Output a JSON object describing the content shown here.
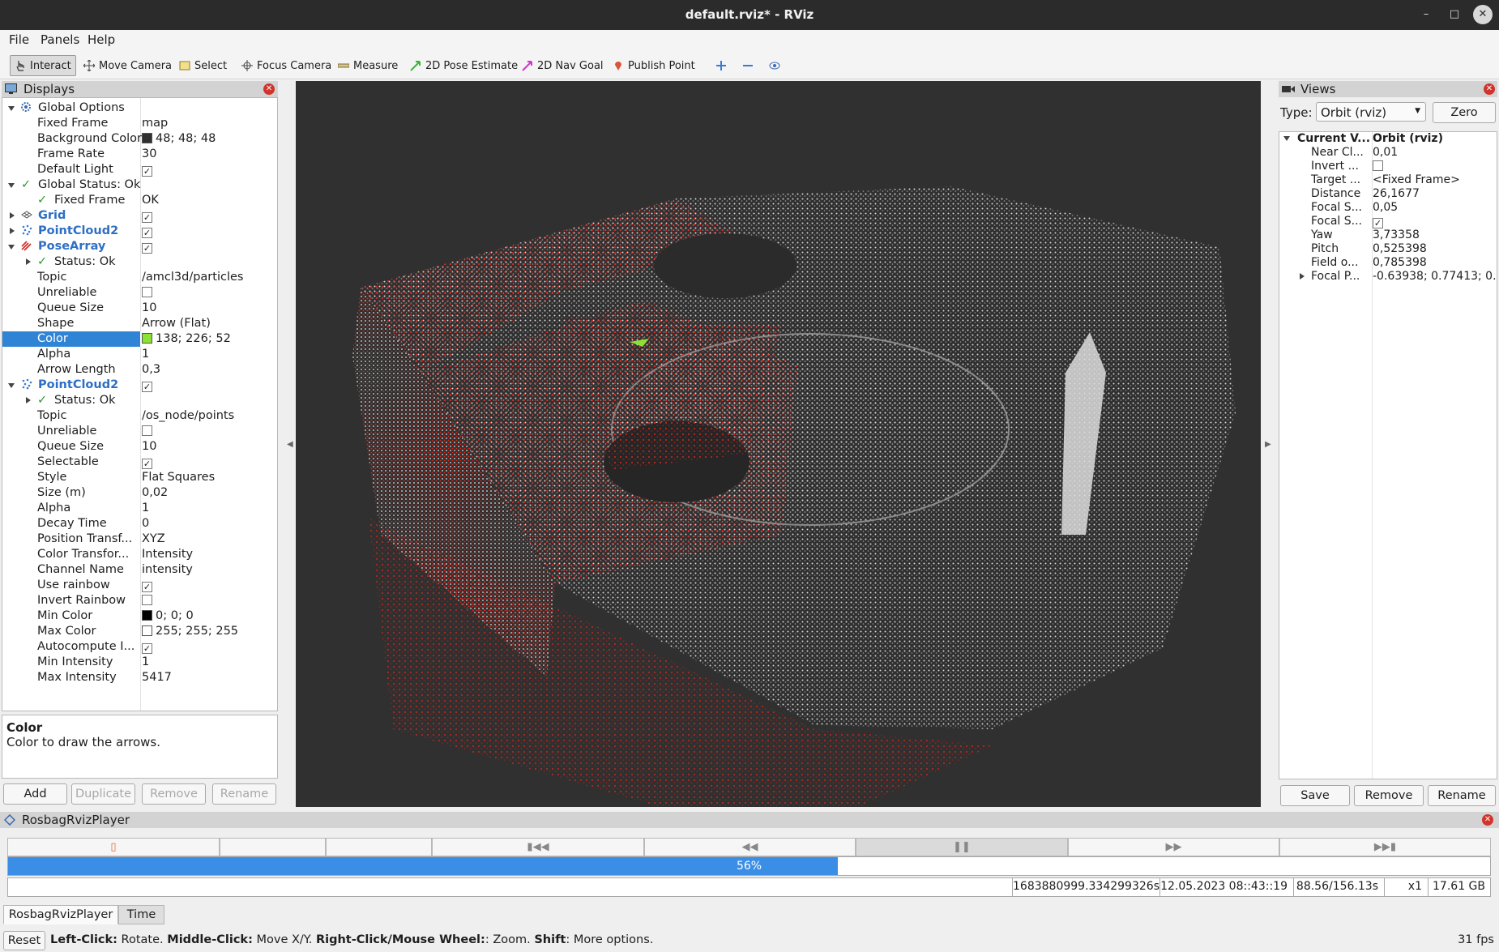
{
  "window": {
    "title": "default.rviz* - RViz"
  },
  "menu": {
    "file": "File",
    "panels": "Panels",
    "help": "Help"
  },
  "toolbar": {
    "interact": "Interact",
    "move_camera": "Move Camera",
    "select": "Select",
    "focus_camera": "Focus Camera",
    "measure": "Measure",
    "pose_estimate": "2D Pose Estimate",
    "nav_goal": "2D Nav Goal",
    "publish_point": "Publish Point"
  },
  "displays": {
    "title": "Displays",
    "rows": [
      {
        "label": "Global Options",
        "value": ""
      },
      {
        "label": "Fixed Frame",
        "value": "map"
      },
      {
        "label": "Background Color",
        "value": "48; 48; 48"
      },
      {
        "label": "Frame Rate",
        "value": "30"
      },
      {
        "label": "Default Light",
        "value": ""
      },
      {
        "label": "Global Status: Ok",
        "value": ""
      },
      {
        "label": "Fixed Frame",
        "value": "OK"
      },
      {
        "label": "Grid",
        "value": ""
      },
      {
        "label": "PointCloud2",
        "value": ""
      },
      {
        "label": "PoseArray",
        "value": ""
      },
      {
        "label": "Status: Ok",
        "value": ""
      },
      {
        "label": "Topic",
        "value": "/amcl3d/particles"
      },
      {
        "label": "Unreliable",
        "value": ""
      },
      {
        "label": "Queue Size",
        "value": "10"
      },
      {
        "label": "Shape",
        "value": "Arrow (Flat)"
      },
      {
        "label": "Color",
        "value": "138; 226; 52"
      },
      {
        "label": "Alpha",
        "value": "1"
      },
      {
        "label": "Arrow Length",
        "value": "0,3"
      },
      {
        "label": "PointCloud2",
        "value": ""
      },
      {
        "label": "Status: Ok",
        "value": ""
      },
      {
        "label": "Topic",
        "value": "/os_node/points"
      },
      {
        "label": "Unreliable",
        "value": ""
      },
      {
        "label": "Queue Size",
        "value": "10"
      },
      {
        "label": "Selectable",
        "value": ""
      },
      {
        "label": "Style",
        "value": "Flat Squares"
      },
      {
        "label": "Size (m)",
        "value": "0,02"
      },
      {
        "label": "Alpha",
        "value": "1"
      },
      {
        "label": "Decay Time",
        "value": "0"
      },
      {
        "label": "Position Transf...",
        "value": "XYZ"
      },
      {
        "label": "Color Transfor...",
        "value": "Intensity"
      },
      {
        "label": "Channel Name",
        "value": "intensity"
      },
      {
        "label": "Use rainbow",
        "value": ""
      },
      {
        "label": "Invert Rainbow",
        "value": ""
      },
      {
        "label": "Min Color",
        "value": "0; 0; 0"
      },
      {
        "label": "Max Color",
        "value": "255; 255; 255"
      },
      {
        "label": "Autocompute I...",
        "value": ""
      },
      {
        "label": "Min Intensity",
        "value": "1"
      },
      {
        "label": "Max Intensity",
        "value": "5417"
      }
    ],
    "description_title": "Color",
    "description_text": "Color to draw the arrows.",
    "buttons": {
      "add": "Add",
      "duplicate": "Duplicate",
      "remove": "Remove",
      "rename": "Rename"
    },
    "colors": {
      "background": "#303030",
      "pose": "#8ae234",
      "min": "#000000",
      "max": "#ffffff"
    }
  },
  "views": {
    "title": "Views",
    "type_label": "Type:",
    "type_value": "Orbit (rviz)",
    "zero": "Zero",
    "rows": [
      {
        "label": "Current V...",
        "value": "Orbit (rviz)"
      },
      {
        "label": "Near Cl...",
        "value": "0,01"
      },
      {
        "label": "Invert ...",
        "value": ""
      },
      {
        "label": "Target ...",
        "value": "<Fixed Frame>"
      },
      {
        "label": "Distance",
        "value": "26,1677"
      },
      {
        "label": "Focal S...",
        "value": "0,05"
      },
      {
        "label": "Focal S...",
        "value": ""
      },
      {
        "label": "Yaw",
        "value": "3,73358"
      },
      {
        "label": "Pitch",
        "value": "0,525398"
      },
      {
        "label": "Field o...",
        "value": "0,785398"
      },
      {
        "label": "Focal P...",
        "value": "-0.63938; 0.77413; 0..."
      }
    ],
    "buttons": {
      "save": "Save",
      "remove": "Remove",
      "rename": "Rename"
    }
  },
  "rosbag": {
    "title": "RosbagRvizPlayer",
    "progress": 0.56,
    "progress_label": "56%",
    "stamp": "1683880999.334299326s",
    "datetime": "12.05.2023 08::43::19",
    "elapsed": "88.56/156.13s",
    "rate": "x1",
    "size": "17.61 GB",
    "tabs": {
      "player": "RosbagRvizPlayer",
      "time": "Time"
    }
  },
  "status": {
    "reset": "Reset",
    "hint_b1": "Left-Click:",
    "hint_t1": " Rotate. ",
    "hint_b2": "Middle-Click:",
    "hint_t2": " Move X/Y. ",
    "hint_b3": "Right-Click/Mouse Wheel:",
    "hint_t3": ": Zoom. ",
    "hint_b4": "Shift",
    "hint_t4": ": More options.",
    "fps": "31 fps"
  }
}
